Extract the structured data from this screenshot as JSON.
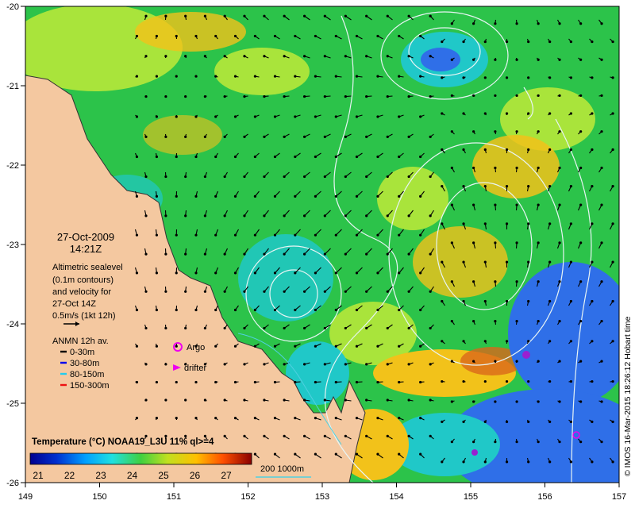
{
  "map": {
    "date": "27-Oct-2009",
    "time": "14:21Z",
    "altimetry_lines": [
      "Altimetric sealevel",
      "(0.1m contours)",
      "and velocity for",
      "27-Oct 14Z",
      "0.5m/s (1kt 12h)"
    ],
    "anmn_title": "ANMN 12h av.",
    "anmn_items": [
      {
        "label": "0-30m",
        "color": "#000000"
      },
      {
        "label": "30-80m",
        "color": "#0000ee"
      },
      {
        "label": "80-150m",
        "color": "#22ccee"
      },
      {
        "label": "150-300m",
        "color": "#ee1111"
      }
    ],
    "argo_label": "Argo",
    "drifter_label": "drifter",
    "marker_color": "#ee00ee",
    "colorbar_title": "Temperature (°C) NOAA19_L3U 11% ql>=4",
    "colorbar_ticks": [
      "21",
      "22",
      "23",
      "24",
      "25",
      "26",
      "27"
    ],
    "isobath_label": "200 1000m",
    "credit": "© IMOS 16-Mar-2015 18:26:12 Hobart time",
    "lon_ticks": [
      "149",
      "150",
      "151",
      "152",
      "153",
      "154",
      "155",
      "156",
      "157"
    ],
    "lat_ticks": [
      "-20",
      "-21",
      "-22",
      "-23",
      "-24",
      "-25",
      "-26"
    ],
    "colors": {
      "land": "#f4c8a0",
      "cold": "#2f6fe8",
      "cool": "#20c8c8",
      "mid": "#2cc34a",
      "warm": "#a9e43b",
      "hot": "#f2c21a",
      "hottest": "#d9681a"
    }
  }
}
